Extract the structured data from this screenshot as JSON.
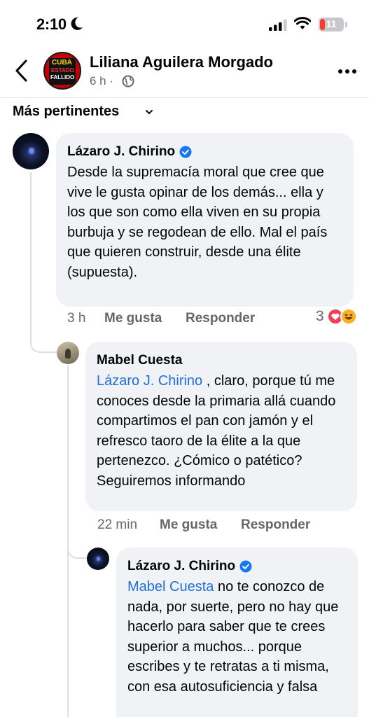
{
  "status_bar": {
    "time": "2:10",
    "battery": "11"
  },
  "header": {
    "page_name": "Liliana Aguilera Morgado",
    "time_label": "6 h ·",
    "avatar_logo_words": [
      "CUBA",
      "ESTADO",
      "FALLIDO"
    ]
  },
  "sort": {
    "label": "Más pertinentes"
  },
  "comments": [
    {
      "author": "Lázaro J. Chirino",
      "verified": true,
      "text": "Desde la supremacía moral que cree que vive le gusta opinar de los demás... ella y los que son como ella viven en su propia burbuja y se regodean de ello. Mal el país que quieren construir, desde una élite (supuesta).",
      "time": "3 h",
      "like_label": "Me gusta",
      "reply_label": "Responder",
      "reaction_count": "3"
    },
    {
      "author": "Mabel Cuesta",
      "mention": "Lázaro J. Chirino",
      "text": " , claro, porque tú me conoces desde la primaria allá cuando compartimos el pan con jamón y el refresco taoro de la élite a la que pertenezco. ¿Cómico o patético? Seguiremos informando",
      "time": "22 min",
      "like_label": "Me gusta",
      "reply_label": "Responder"
    },
    {
      "author": "Lázaro J. Chirino",
      "verified": true,
      "mention": "Mabel Cuesta",
      "text": " no te conozco de nada, por suerte, pero no hay que hacerlo para saber que te crees superior a muchos... porque escribes y te retratas a ti misma, con esa autosuficiencia y falsa"
    }
  ],
  "colors": {
    "link": "#216fdb",
    "bubble": "#f0f2f5",
    "meta": "#65676b"
  }
}
